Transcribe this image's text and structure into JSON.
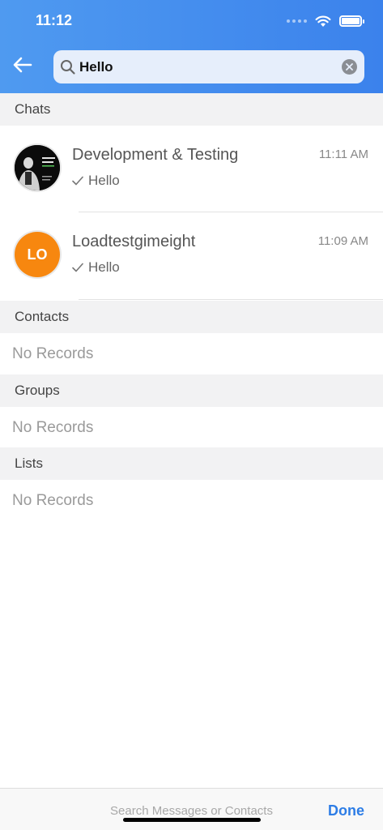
{
  "status_bar": {
    "time": "11:12"
  },
  "search": {
    "query": "Hello"
  },
  "sections": {
    "chats": "Chats",
    "contacts": "Contacts",
    "groups": "Groups",
    "lists": "Lists"
  },
  "chats": [
    {
      "name": "Development & Testing",
      "time": "11:11 AM",
      "last_message": "Hello",
      "avatar_type": "photo"
    },
    {
      "name": "Loadtestgimeight",
      "time": "11:09 AM",
      "last_message": "Hello",
      "avatar_initials": "LO",
      "avatar_color": "#f7870f"
    }
  ],
  "empty_states": {
    "contacts": "No Records",
    "groups": "No Records",
    "lists": "No Records"
  },
  "bottom_bar": {
    "placeholder": "Search Messages or Contacts",
    "done_label": "Done"
  },
  "colors": {
    "header": "#3b82ec",
    "accent": "#2d7de6",
    "avatar_orange": "#f7870f"
  }
}
